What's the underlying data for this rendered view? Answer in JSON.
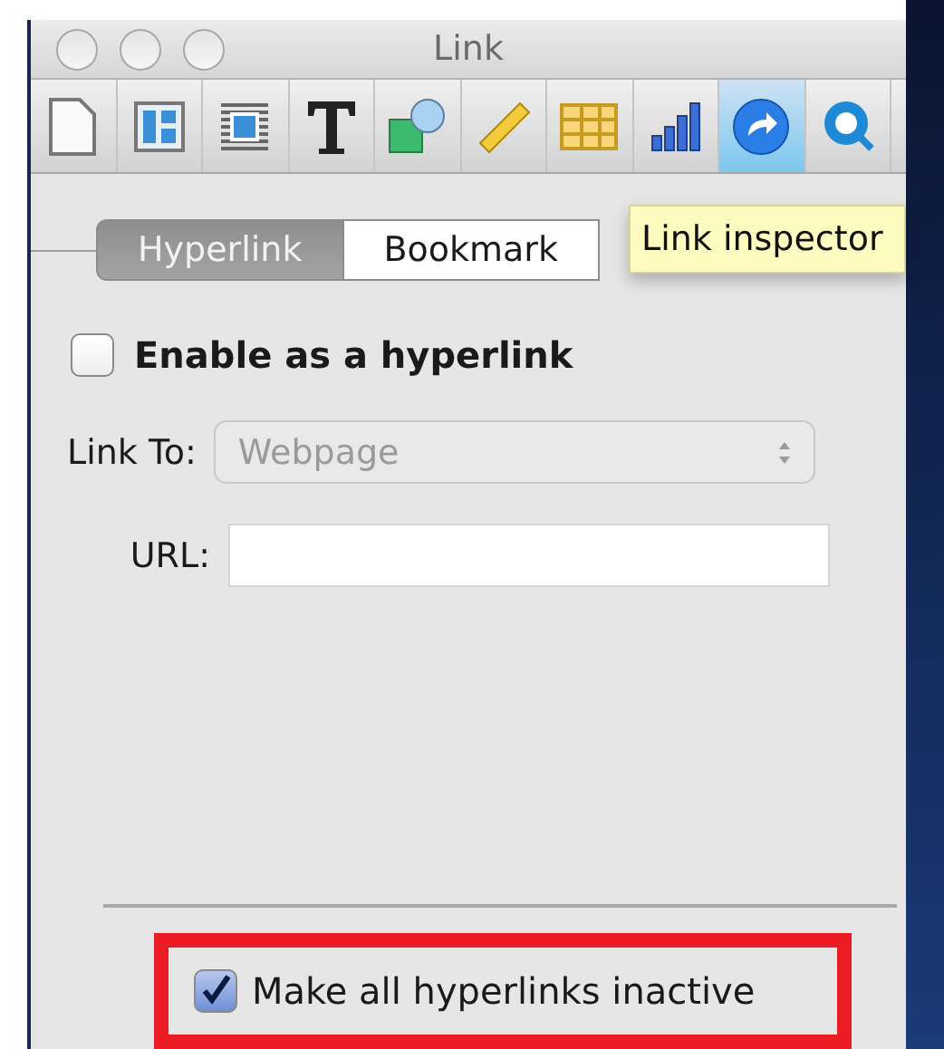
{
  "window": {
    "title": "Link"
  },
  "toolbar": [
    {
      "kind": "document",
      "selected": false
    },
    {
      "kind": "layout",
      "selected": false
    },
    {
      "kind": "wrap",
      "selected": false
    },
    {
      "kind": "text",
      "selected": false
    },
    {
      "kind": "shapes",
      "selected": false
    },
    {
      "kind": "ruler",
      "selected": false
    },
    {
      "kind": "table",
      "selected": false
    },
    {
      "kind": "chart",
      "selected": false
    },
    {
      "kind": "link",
      "selected": true
    },
    {
      "kind": "quicktime",
      "selected": false
    }
  ],
  "tabs": [
    {
      "label": "Hyperlink",
      "selected": true
    },
    {
      "label": "Bookmark",
      "selected": false
    }
  ],
  "tooltip": "Link inspector",
  "enable_checkbox": {
    "label": "Enable as a hyperlink",
    "checked": false
  },
  "link_to": {
    "label": "Link To:",
    "value": "Webpage",
    "disabled": true
  },
  "url": {
    "label": "URL:"
  },
  "inactive_checkbox": {
    "label": "Make all hyperlinks inactive",
    "checked": true,
    "highlighted": true
  }
}
